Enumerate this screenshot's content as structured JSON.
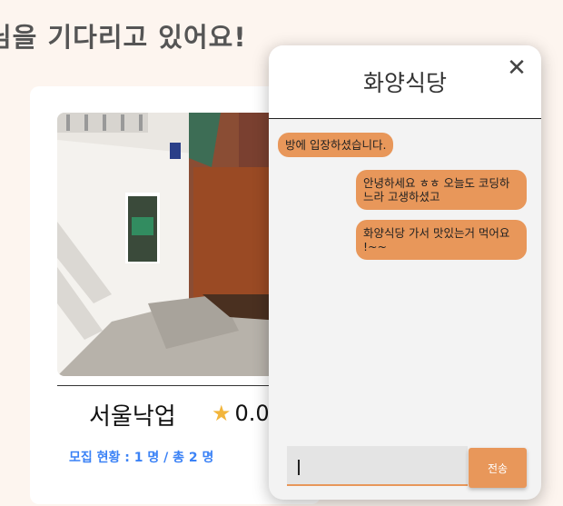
{
  "page": {
    "heading": "님을 기다리고 있어요!"
  },
  "card": {
    "name": "서울낙업",
    "rating_star": "★",
    "rating": "0.0",
    "recruit_status": "모집 현황 : 1 명 / 총 2 명"
  },
  "chat": {
    "title": "화양식당",
    "close_icon": "✕",
    "messages": [
      {
        "type": "system",
        "text": "방에 입장하셨습니다."
      },
      {
        "type": "user",
        "text": "안녕하세요 ㅎㅎ 오늘도 코딩하느라 고생하셨고"
      },
      {
        "type": "user",
        "text": "화양식당 가서 맛있는거 먹어요 !~~"
      }
    ],
    "input_value": "",
    "send_label": "전송"
  },
  "colors": {
    "accent": "#e8975a",
    "link_blue": "#3b82f6",
    "star": "#f2b53b",
    "background": "#fdf5ef"
  }
}
